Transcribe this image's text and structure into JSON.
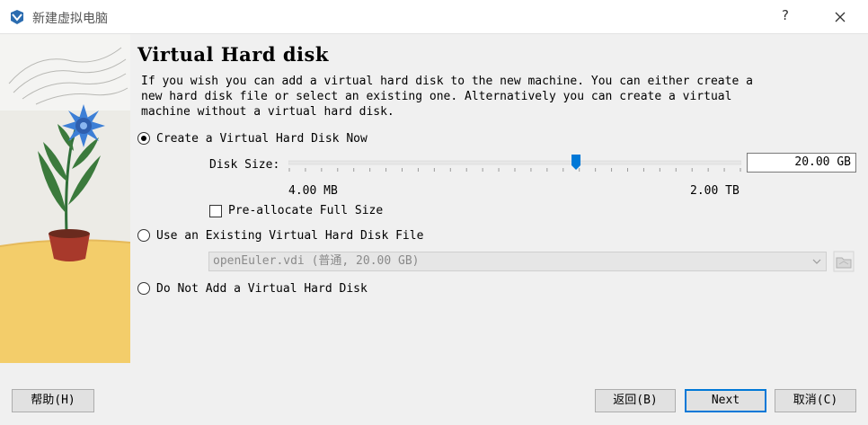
{
  "window": {
    "title": "新建虚拟电脑",
    "help_symbol": "?",
    "icons": {
      "app": "virtualbox-icon",
      "close": "close-icon"
    }
  },
  "page": {
    "heading": "Virtual Hard disk",
    "description": "If you wish you can add a virtual hard disk to the new machine. You can either create a\nnew hard disk file or select an existing one. Alternatively you can create a virtual\nmachine without a virtual hard disk."
  },
  "options": {
    "create": {
      "label": "Create a Virtual Hard Disk Now",
      "checked": true
    },
    "existing": {
      "label": "Use an Existing Virtual Hard Disk File",
      "checked": false
    },
    "none": {
      "label": "Do Not Add a Virtual Hard Disk",
      "checked": false
    }
  },
  "disk_size": {
    "label": "Disk Size:",
    "value": "20.00 GB",
    "min_label": "4.00 MB",
    "max_label": "2.00 TB",
    "slider_fraction": 0.635
  },
  "preallocate": {
    "label": "Pre-allocate Full Size",
    "checked": false
  },
  "existing_file": {
    "selected": "openEuler.vdi (普通, 20.00 GB)",
    "folder_icon": "folder-icon"
  },
  "buttons": {
    "help": "帮助(H)",
    "back": "返回(B)",
    "next": "Next",
    "cancel": "取消(C)"
  },
  "colors": {
    "accent": "#0078d7",
    "art_yellow": "#f3cd6a",
    "flower_blue": "#3d7fd6"
  }
}
